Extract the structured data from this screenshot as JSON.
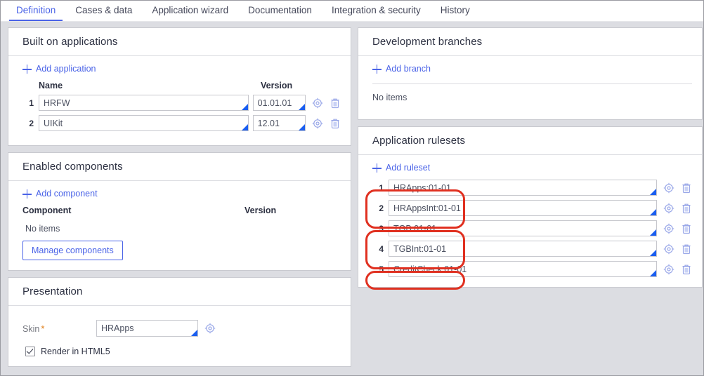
{
  "tabs": [
    {
      "label": "Definition",
      "active": true
    },
    {
      "label": "Cases & data",
      "active": false
    },
    {
      "label": "Application wizard",
      "active": false
    },
    {
      "label": "Documentation",
      "active": false
    },
    {
      "label": "Integration & security",
      "active": false
    },
    {
      "label": "History",
      "active": false
    }
  ],
  "built_on": {
    "title": "Built on applications",
    "add_label": "Add application",
    "columns": {
      "name": "Name",
      "version": "Version"
    },
    "rows": [
      {
        "index": "1",
        "name": "HRFW",
        "version": "01.01.01"
      },
      {
        "index": "2",
        "name": "UIKit",
        "version": "12.01"
      }
    ]
  },
  "enabled_components": {
    "title": "Enabled components",
    "add_label": "Add component",
    "columns": {
      "component": "Component",
      "version": "Version"
    },
    "empty_text": "No items",
    "manage_button": "Manage components"
  },
  "presentation": {
    "title": "Presentation",
    "skin_label": "Skin",
    "required_marker": "*",
    "skin_value": "HRApps",
    "render_html5_label": "Render in HTML5",
    "render_html5_checked": true
  },
  "development_branches": {
    "title": "Development branches",
    "add_label": "Add branch",
    "empty_text": "No items"
  },
  "application_rulesets": {
    "title": "Application rulesets",
    "add_label": "Add ruleset",
    "rows": [
      {
        "index": "1",
        "value": "HRApps:01-01"
      },
      {
        "index": "2",
        "value": "HRAppsInt:01-01"
      },
      {
        "index": "3",
        "value": "TGB:01-01"
      },
      {
        "index": "4",
        "value": "TGBInt:01-01"
      },
      {
        "index": "5",
        "value": "CreditCheck:01-01"
      }
    ],
    "highlight_color": "#e03020",
    "highlight_groups": [
      {
        "rows": [
          "1",
          "2"
        ]
      },
      {
        "rows": [
          "3",
          "4"
        ]
      },
      {
        "rows": [
          "5"
        ]
      }
    ]
  },
  "icons": {
    "open_target": "crosshair-icon",
    "delete": "trash-icon",
    "add": "plus-icon",
    "smart_prompt": "smart-prompt-corner-icon"
  },
  "colors": {
    "accent": "#4a63e7",
    "page_background": "#dcdde2",
    "card_background": "#ffffff",
    "required_asterisk": "#e07b12",
    "annotation_red": "#e03020"
  }
}
